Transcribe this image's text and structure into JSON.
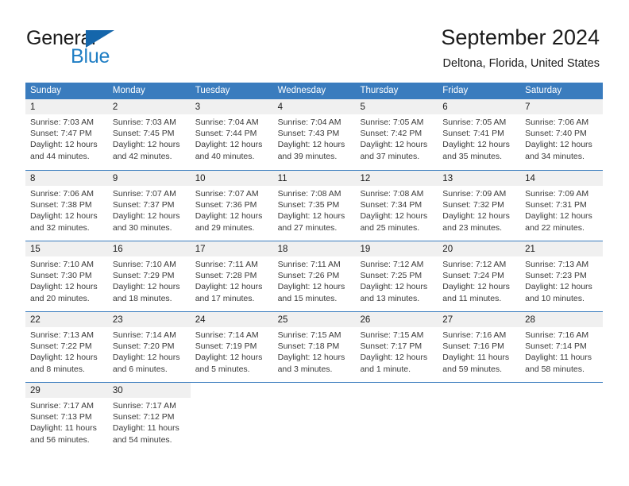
{
  "brand": {
    "name_part1": "General",
    "name_part2": "Blue",
    "logo_icon": "triangle-logo-icon",
    "accent_color": "#1f7ec4"
  },
  "header": {
    "title": "September 2024",
    "subtitle": "Deltona, Florida, United States"
  },
  "theme": {
    "header_blue": "#3a7cbe",
    "day_band_gray": "#f0f0f0",
    "text_color": "#1b1b1b"
  },
  "weekdays": [
    "Sunday",
    "Monday",
    "Tuesday",
    "Wednesday",
    "Thursday",
    "Friday",
    "Saturday"
  ],
  "weeks": [
    {
      "days": [
        {
          "date": "1",
          "sunrise": "Sunrise: 7:03 AM",
          "sunset": "Sunset: 7:47 PM",
          "daylight1": "Daylight: 12 hours",
          "daylight2": "and 44 minutes."
        },
        {
          "date": "2",
          "sunrise": "Sunrise: 7:03 AM",
          "sunset": "Sunset: 7:45 PM",
          "daylight1": "Daylight: 12 hours",
          "daylight2": "and 42 minutes."
        },
        {
          "date": "3",
          "sunrise": "Sunrise: 7:04 AM",
          "sunset": "Sunset: 7:44 PM",
          "daylight1": "Daylight: 12 hours",
          "daylight2": "and 40 minutes."
        },
        {
          "date": "4",
          "sunrise": "Sunrise: 7:04 AM",
          "sunset": "Sunset: 7:43 PM",
          "daylight1": "Daylight: 12 hours",
          "daylight2": "and 39 minutes."
        },
        {
          "date": "5",
          "sunrise": "Sunrise: 7:05 AM",
          "sunset": "Sunset: 7:42 PM",
          "daylight1": "Daylight: 12 hours",
          "daylight2": "and 37 minutes."
        },
        {
          "date": "6",
          "sunrise": "Sunrise: 7:05 AM",
          "sunset": "Sunset: 7:41 PM",
          "daylight1": "Daylight: 12 hours",
          "daylight2": "and 35 minutes."
        },
        {
          "date": "7",
          "sunrise": "Sunrise: 7:06 AM",
          "sunset": "Sunset: 7:40 PM",
          "daylight1": "Daylight: 12 hours",
          "daylight2": "and 34 minutes."
        }
      ]
    },
    {
      "days": [
        {
          "date": "8",
          "sunrise": "Sunrise: 7:06 AM",
          "sunset": "Sunset: 7:38 PM",
          "daylight1": "Daylight: 12 hours",
          "daylight2": "and 32 minutes."
        },
        {
          "date": "9",
          "sunrise": "Sunrise: 7:07 AM",
          "sunset": "Sunset: 7:37 PM",
          "daylight1": "Daylight: 12 hours",
          "daylight2": "and 30 minutes."
        },
        {
          "date": "10",
          "sunrise": "Sunrise: 7:07 AM",
          "sunset": "Sunset: 7:36 PM",
          "daylight1": "Daylight: 12 hours",
          "daylight2": "and 29 minutes."
        },
        {
          "date": "11",
          "sunrise": "Sunrise: 7:08 AM",
          "sunset": "Sunset: 7:35 PM",
          "daylight1": "Daylight: 12 hours",
          "daylight2": "and 27 minutes."
        },
        {
          "date": "12",
          "sunrise": "Sunrise: 7:08 AM",
          "sunset": "Sunset: 7:34 PM",
          "daylight1": "Daylight: 12 hours",
          "daylight2": "and 25 minutes."
        },
        {
          "date": "13",
          "sunrise": "Sunrise: 7:09 AM",
          "sunset": "Sunset: 7:32 PM",
          "daylight1": "Daylight: 12 hours",
          "daylight2": "and 23 minutes."
        },
        {
          "date": "14",
          "sunrise": "Sunrise: 7:09 AM",
          "sunset": "Sunset: 7:31 PM",
          "daylight1": "Daylight: 12 hours",
          "daylight2": "and 22 minutes."
        }
      ]
    },
    {
      "days": [
        {
          "date": "15",
          "sunrise": "Sunrise: 7:10 AM",
          "sunset": "Sunset: 7:30 PM",
          "daylight1": "Daylight: 12 hours",
          "daylight2": "and 20 minutes."
        },
        {
          "date": "16",
          "sunrise": "Sunrise: 7:10 AM",
          "sunset": "Sunset: 7:29 PM",
          "daylight1": "Daylight: 12 hours",
          "daylight2": "and 18 minutes."
        },
        {
          "date": "17",
          "sunrise": "Sunrise: 7:11 AM",
          "sunset": "Sunset: 7:28 PM",
          "daylight1": "Daylight: 12 hours",
          "daylight2": "and 17 minutes."
        },
        {
          "date": "18",
          "sunrise": "Sunrise: 7:11 AM",
          "sunset": "Sunset: 7:26 PM",
          "daylight1": "Daylight: 12 hours",
          "daylight2": "and 15 minutes."
        },
        {
          "date": "19",
          "sunrise": "Sunrise: 7:12 AM",
          "sunset": "Sunset: 7:25 PM",
          "daylight1": "Daylight: 12 hours",
          "daylight2": "and 13 minutes."
        },
        {
          "date": "20",
          "sunrise": "Sunrise: 7:12 AM",
          "sunset": "Sunset: 7:24 PM",
          "daylight1": "Daylight: 12 hours",
          "daylight2": "and 11 minutes."
        },
        {
          "date": "21",
          "sunrise": "Sunrise: 7:13 AM",
          "sunset": "Sunset: 7:23 PM",
          "daylight1": "Daylight: 12 hours",
          "daylight2": "and 10 minutes."
        }
      ]
    },
    {
      "days": [
        {
          "date": "22",
          "sunrise": "Sunrise: 7:13 AM",
          "sunset": "Sunset: 7:22 PM",
          "daylight1": "Daylight: 12 hours",
          "daylight2": "and 8 minutes."
        },
        {
          "date": "23",
          "sunrise": "Sunrise: 7:14 AM",
          "sunset": "Sunset: 7:20 PM",
          "daylight1": "Daylight: 12 hours",
          "daylight2": "and 6 minutes."
        },
        {
          "date": "24",
          "sunrise": "Sunrise: 7:14 AM",
          "sunset": "Sunset: 7:19 PM",
          "daylight1": "Daylight: 12 hours",
          "daylight2": "and 5 minutes."
        },
        {
          "date": "25",
          "sunrise": "Sunrise: 7:15 AM",
          "sunset": "Sunset: 7:18 PM",
          "daylight1": "Daylight: 12 hours",
          "daylight2": "and 3 minutes."
        },
        {
          "date": "26",
          "sunrise": "Sunrise: 7:15 AM",
          "sunset": "Sunset: 7:17 PM",
          "daylight1": "Daylight: 12 hours",
          "daylight2": "and 1 minute."
        },
        {
          "date": "27",
          "sunrise": "Sunrise: 7:16 AM",
          "sunset": "Sunset: 7:16 PM",
          "daylight1": "Daylight: 11 hours",
          "daylight2": "and 59 minutes."
        },
        {
          "date": "28",
          "sunrise": "Sunrise: 7:16 AM",
          "sunset": "Sunset: 7:14 PM",
          "daylight1": "Daylight: 11 hours",
          "daylight2": "and 58 minutes."
        }
      ]
    },
    {
      "days": [
        {
          "date": "29",
          "sunrise": "Sunrise: 7:17 AM",
          "sunset": "Sunset: 7:13 PM",
          "daylight1": "Daylight: 11 hours",
          "daylight2": "and 56 minutes."
        },
        {
          "date": "30",
          "sunrise": "Sunrise: 7:17 AM",
          "sunset": "Sunset: 7:12 PM",
          "daylight1": "Daylight: 11 hours",
          "daylight2": "and 54 minutes."
        },
        {
          "date": "",
          "sunrise": "",
          "sunset": "",
          "daylight1": "",
          "daylight2": ""
        },
        {
          "date": "",
          "sunrise": "",
          "sunset": "",
          "daylight1": "",
          "daylight2": ""
        },
        {
          "date": "",
          "sunrise": "",
          "sunset": "",
          "daylight1": "",
          "daylight2": ""
        },
        {
          "date": "",
          "sunrise": "",
          "sunset": "",
          "daylight1": "",
          "daylight2": ""
        },
        {
          "date": "",
          "sunrise": "",
          "sunset": "",
          "daylight1": "",
          "daylight2": ""
        }
      ]
    }
  ]
}
